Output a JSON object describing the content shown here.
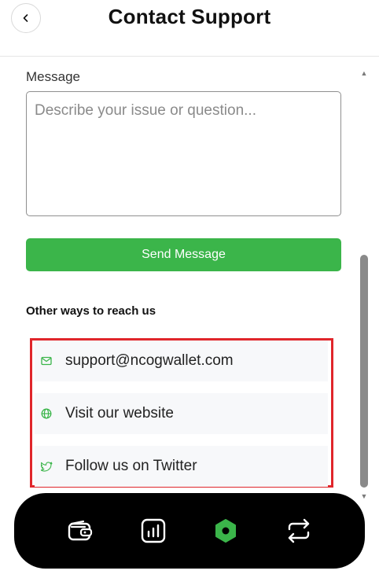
{
  "header": {
    "title": "Contact Support"
  },
  "form": {
    "message_label": "Message",
    "message_placeholder": "Describe your issue or question...",
    "message_value": "",
    "send_label": "Send Message"
  },
  "other_ways": {
    "heading": "Other ways to reach us",
    "items": [
      {
        "icon": "mail-icon",
        "label": "support@ncogwallet.com"
      },
      {
        "icon": "globe-icon",
        "label": "Visit our website"
      },
      {
        "icon": "twitter-icon",
        "label": "Follow us on Twitter"
      }
    ]
  },
  "bottom_nav": {
    "items": [
      {
        "icon": "wallet-icon",
        "active": false
      },
      {
        "icon": "bar-chart-icon",
        "active": false
      },
      {
        "icon": "hexagon-icon",
        "active": true
      },
      {
        "icon": "swap-arrows-icon",
        "active": false
      }
    ]
  },
  "colors": {
    "accent_green": "#3bb54a",
    "highlight_red": "#e0262b",
    "nav_background": "#000000"
  }
}
